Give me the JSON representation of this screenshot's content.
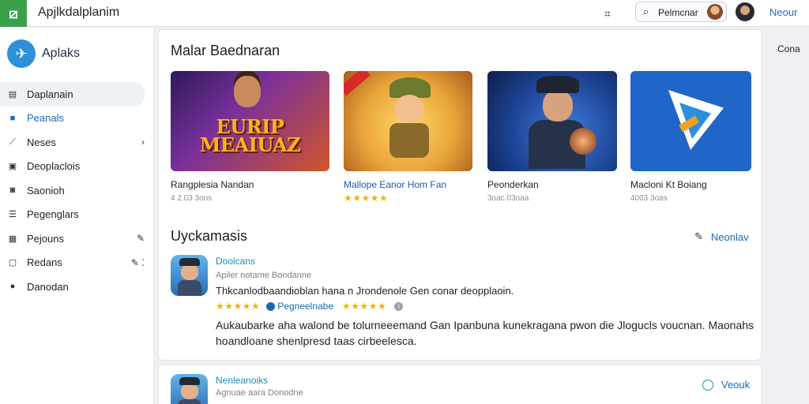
{
  "topbar": {
    "app_title": "Apjlkdalplanim",
    "search_text": "Pelmcnar",
    "link": "Neour"
  },
  "sidebar": {
    "brand": "Aplaks",
    "items": [
      {
        "label": "Daplanain",
        "icon": "document-icon"
      },
      {
        "label": "Peanals",
        "icon": "bookmark-icon"
      },
      {
        "label": "Neses",
        "icon": "trend-icon"
      },
      {
        "label": "Deoplaclois",
        "icon": "image-icon"
      },
      {
        "label": "Saonioh",
        "icon": "camera-icon"
      },
      {
        "label": "Pegenglars",
        "icon": "list-icon"
      },
      {
        "label": "Pejouns",
        "icon": "grid-icon"
      },
      {
        "label": "Redans",
        "icon": "clipboard-icon"
      },
      {
        "label": "Danodan",
        "icon": "palette-icon"
      }
    ]
  },
  "featured": {
    "title": "Malar Baednaran",
    "cards": [
      {
        "name": "Rangplesia Nandan",
        "sub": "4 2.03 3ons",
        "art_text": "EURIP MEAIUAZ"
      },
      {
        "name": "Mallope Eanor  Hom Fan",
        "stars": "★★★★★"
      },
      {
        "name": "Peonderkan",
        "sub": "3oac.03oaa"
      },
      {
        "name": "Macloni Kt Boiang",
        "sub": "4003 3oas"
      }
    ]
  },
  "list": {
    "title": "Uyckamasis",
    "action": "Neonlav",
    "item1": {
      "title": "Doolcans",
      "sub": "Apiler notame Bondanne",
      "desc": "Thkcanlodbaandioblan hana n Jrondenole Gen conar deopplaoin.",
      "stars_a": "★★★★★",
      "tag": "Pegneelnabe",
      "stars_b": "★★★★★",
      "body": "Aukaubarke aha walond be tolurneeemand Gan Ipanbuna kunekragana pwon die Jlogucls voucnan. Maonahs hoandloane shenlpresd taas cirbeelesca."
    },
    "item2": {
      "title": "Nenleanoiks",
      "sub": "Agnuae aara Donodne",
      "action": "Veouk"
    }
  },
  "right_label": "Cona"
}
